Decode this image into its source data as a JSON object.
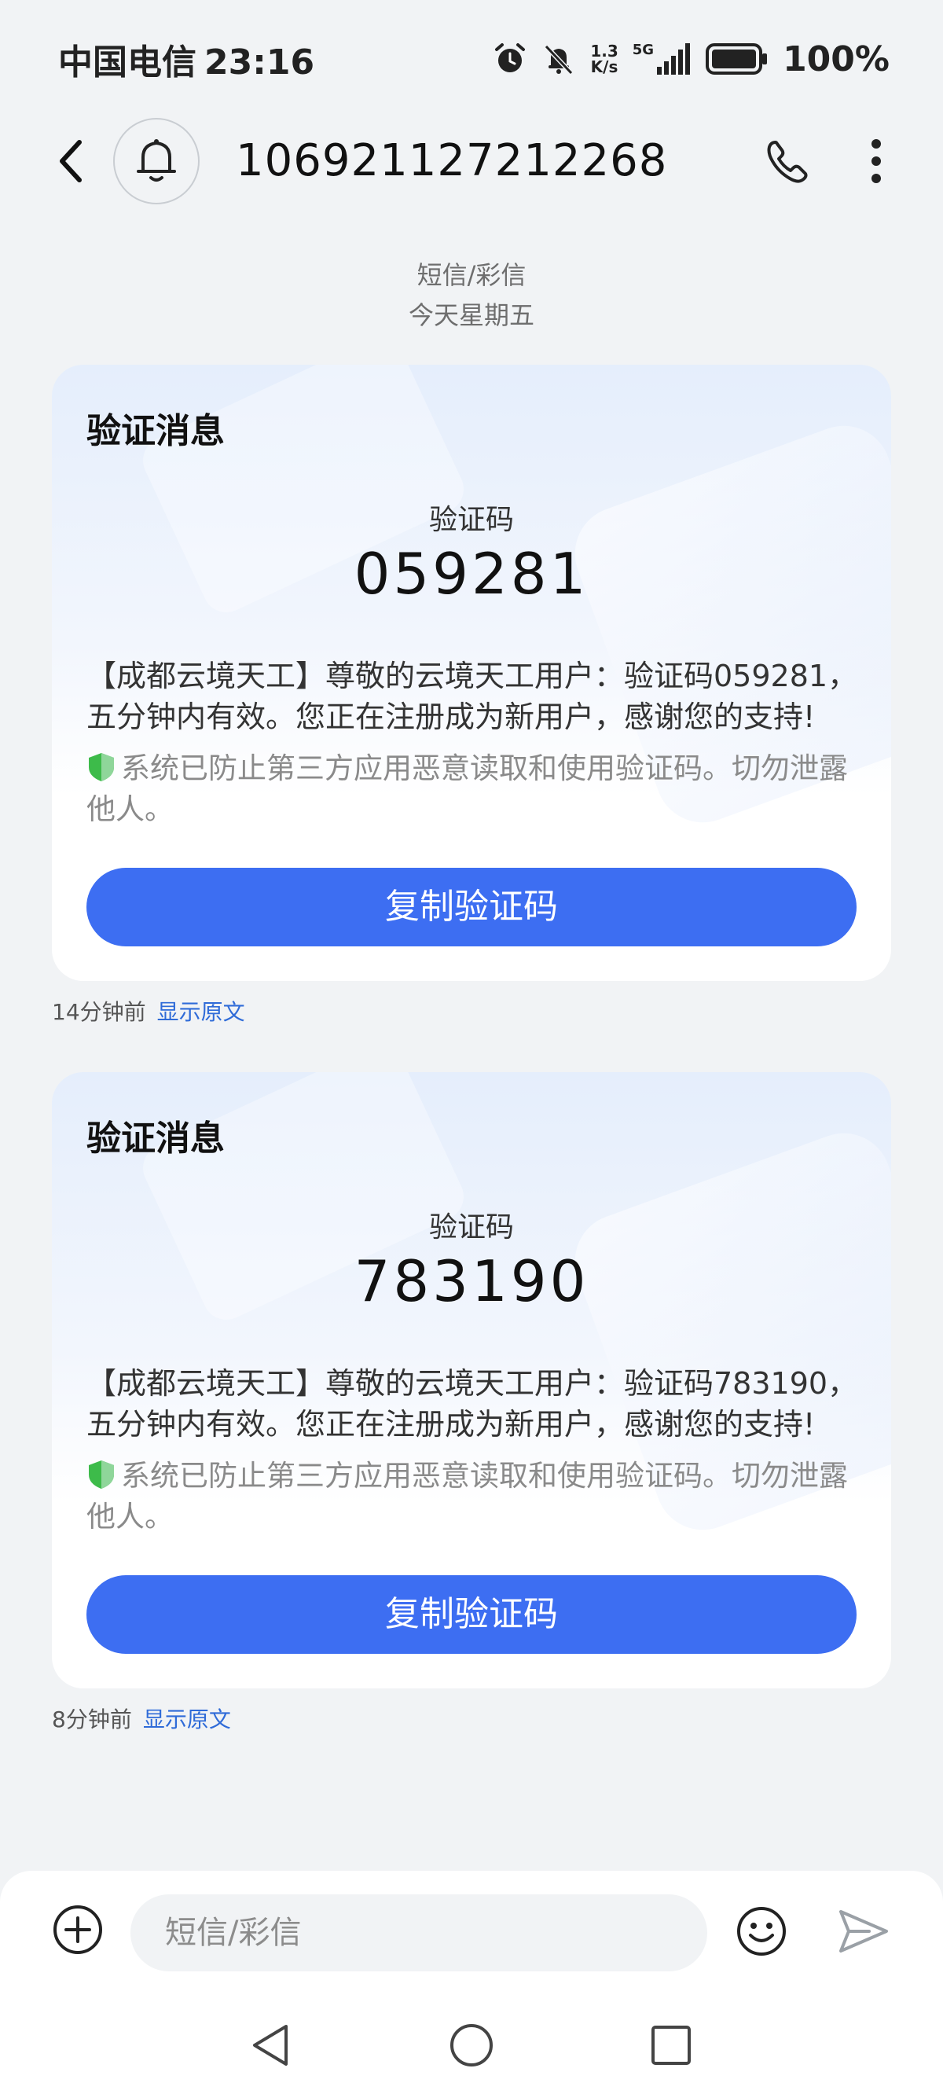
{
  "status_bar": {
    "carrier": "中国电信",
    "time": "23:16",
    "net_speed_value": "1.3",
    "net_speed_unit": "K/s",
    "network": "5G",
    "battery": "100%"
  },
  "header": {
    "contact": "106921127212268"
  },
  "thread_meta": {
    "type": "短信/彩信",
    "date": "今天星期五"
  },
  "messages": [
    {
      "card_title": "验证消息",
      "code_label": "验证码",
      "code": "059281",
      "body": "【成都云境天工】尊敬的云境天工用户：验证码059281，五分钟内有效。您正在注册成为新用户，感谢您的支持!",
      "security_note": "系统已防止第三方应用恶意读取和使用验证码。切勿泄露他人。",
      "copy_label": "复制验证码",
      "time_ago": "14分钟前",
      "show_original": "显示原文"
    },
    {
      "card_title": "验证消息",
      "code_label": "验证码",
      "code": "783190",
      "body": "【成都云境天工】尊敬的云境天工用户：验证码783190，五分钟内有效。您正在注册成为新用户，感谢您的支持!",
      "security_note": "系统已防止第三方应用恶意读取和使用验证码。切勿泄露他人。",
      "copy_label": "复制验证码",
      "time_ago": "8分钟前",
      "show_original": "显示原文"
    }
  ],
  "input_bar": {
    "placeholder": "短信/彩信",
    "value": ""
  },
  "icons": {
    "back": "back-arrow-icon",
    "avatar": "bell-icon",
    "call": "phone-icon",
    "more": "more-vertical-icon",
    "shield": "shield-icon",
    "add": "plus-circle-icon",
    "emoji": "emoji-icon",
    "send": "send-icon"
  },
  "colors": {
    "accent": "#3d6ef2",
    "link": "#2f6bd8",
    "shield_green": "#3dbb4a",
    "background": "#f1f3f5"
  }
}
